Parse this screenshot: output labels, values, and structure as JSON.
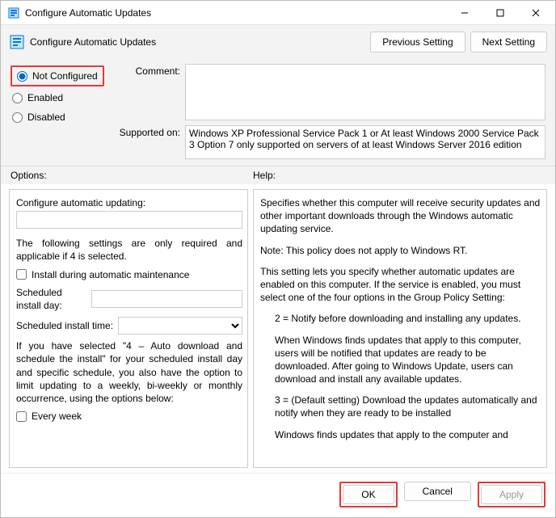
{
  "window": {
    "title": "Configure Automatic Updates"
  },
  "header": {
    "title": "Configure Automatic Updates",
    "prev_btn": "Previous Setting",
    "next_btn": "Next Setting"
  },
  "state": {
    "not_configured": "Not Configured",
    "enabled": "Enabled",
    "disabled": "Disabled"
  },
  "fields": {
    "comment_label": "Comment:",
    "comment_value": "",
    "supported_label": "Supported on:",
    "supported_value": "Windows XP Professional Service Pack 1 or At least Windows 2000 Service Pack 3 Option 7 only supported on servers of at least Windows Server 2016 edition"
  },
  "sections": {
    "options": "Options:",
    "help": "Help:"
  },
  "options": {
    "heading": "Configure automatic updating:",
    "note": "The following settings are only required and applicable if 4 is selected.",
    "install_maint": "Install during automatic maintenance",
    "day_label": "Scheduled install day:",
    "day_value": "",
    "time_label": "Scheduled install time:",
    "time_value": "",
    "para": "If you have selected \"4 – Auto download and schedule the install\" for your scheduled install day and specific schedule, you also have the option to limit updating to a weekly, bi-weekly or monthly occurrence, using the options below:",
    "every_week": "Every week"
  },
  "help": {
    "p1": "Specifies whether this computer will receive security updates and other important downloads through the Windows automatic updating service.",
    "p2": "Note: This policy does not apply to Windows RT.",
    "p3": "This setting lets you specify whether automatic updates are enabled on this computer. If the service is enabled, you must select one of the four options in the Group Policy Setting:",
    "p4": "2 = Notify before downloading and installing any updates.",
    "p5": "When Windows finds updates that apply to this computer, users will be notified that updates are ready to be downloaded. After going to Windows Update, users can download and install any available updates.",
    "p6": "3 = (Default setting) Download the updates automatically and notify when they are ready to be installed",
    "p7": "Windows finds updates that apply to the computer and"
  },
  "footer": {
    "ok": "OK",
    "cancel": "Cancel",
    "apply": "Apply"
  }
}
